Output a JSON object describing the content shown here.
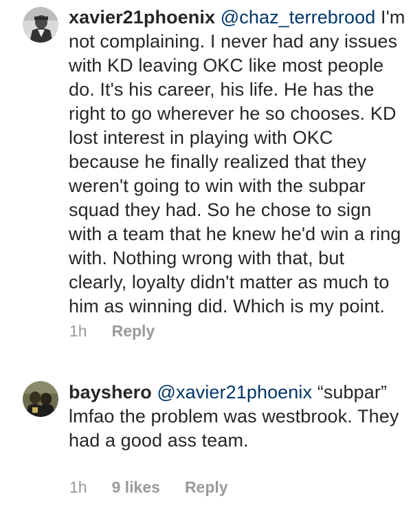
{
  "comments": [
    {
      "username": "xavier21phoenix",
      "mention": "@chaz_terrebrood",
      "text": "I'm not complaining. I never had any issues with KD leaving OKC like most people do. It's his career, his life. He has the right to go wherever he so chooses. KD lost interest in playing with OKC because he finally realized that they weren't going to win with the subpar squad they had. So he chose to sign with a team that he knew he'd win a ring with. Nothing wrong with that, but clearly, loyalty didn't matter as much to him as winning did. Which is my point.",
      "time": "1h",
      "reply_label": "Reply"
    },
    {
      "username": "bayshero",
      "mention": "@xavier21phoenix",
      "text": "“subpar” lmfao the problem was westbrook. They had a good ass team.",
      "time": "1h",
      "likes": "9 likes",
      "reply_label": "Reply"
    }
  ]
}
